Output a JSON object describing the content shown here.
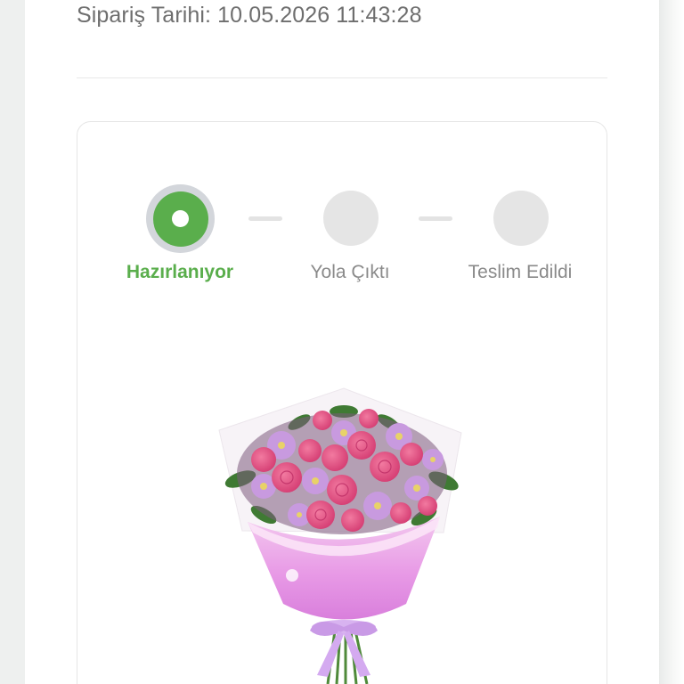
{
  "order": {
    "date_label": "Sipariş Tarihi: 10.05.2026 11:43:28"
  },
  "steps": [
    {
      "label": "Hazırlanıyor",
      "status": "active"
    },
    {
      "label": "Yola Çıktı",
      "status": "pending"
    },
    {
      "label": "Teslim Edildi",
      "status": "pending"
    }
  ],
  "product": {
    "image": "flower-bouquet-icon"
  },
  "colors": {
    "accent": "#5aae4c",
    "inactive": "#e5e5e5",
    "text_muted": "#8a8a8a"
  }
}
